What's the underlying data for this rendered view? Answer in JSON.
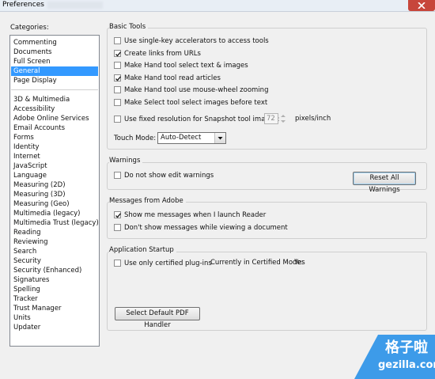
{
  "window": {
    "title": "Preferences"
  },
  "categories": {
    "label": "Categories:",
    "group1": [
      "Commenting",
      "Documents",
      "Full Screen",
      "General",
      "Page Display"
    ],
    "group2": [
      "3D & Multimedia",
      "Accessibility",
      "Adobe Online Services",
      "Email Accounts",
      "Forms",
      "Identity",
      "Internet",
      "JavaScript",
      "Language",
      "Measuring (2D)",
      "Measuring (3D)",
      "Measuring (Geo)",
      "Multimedia (legacy)",
      "Multimedia Trust (legacy)",
      "Reading",
      "Reviewing",
      "Search",
      "Security",
      "Security (Enhanced)",
      "Signatures",
      "Spelling",
      "Tracker",
      "Trust Manager",
      "Units",
      "Updater"
    ],
    "selected": "General"
  },
  "basic_tools": {
    "heading": "Basic Tools",
    "options": [
      {
        "label": "Use single-key accelerators to access tools",
        "checked": false
      },
      {
        "label": "Create links from URLs",
        "checked": true
      },
      {
        "label": "Make Hand tool select text & images",
        "checked": false
      },
      {
        "label": "Make Hand tool read articles",
        "checked": true
      },
      {
        "label": "Make Hand tool use mouse-wheel zooming",
        "checked": false
      },
      {
        "label": "Make Select tool select images before text",
        "checked": false
      }
    ],
    "fixed_resolution": {
      "label": "Use fixed resolution for Snapshot tool images:",
      "checked": false,
      "value": "72",
      "unit": "pixels/inch"
    },
    "touch_mode": {
      "label": "Touch Mode:",
      "value": "Auto-Detect"
    }
  },
  "warnings": {
    "heading": "Warnings",
    "option": {
      "label": "Do not show edit warnings",
      "checked": false
    },
    "reset_button": "Reset All Warnings"
  },
  "messages": {
    "heading": "Messages from Adobe",
    "options": [
      {
        "label": "Show me messages when I launch Reader",
        "checked": true
      },
      {
        "label": "Don't show messages while viewing a document",
        "checked": false
      }
    ]
  },
  "startup": {
    "heading": "Application Startup",
    "option": {
      "label": "Use only certified plug-ins",
      "checked": false
    },
    "certified_label": "Currently in Certified Mode:",
    "certified_value": "Yes",
    "default_pdf_button": "Select Default PDF Handler"
  },
  "watermark": {
    "cn": "格子啦",
    "en": "gezilla.com"
  }
}
